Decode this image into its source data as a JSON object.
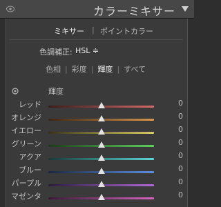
{
  "header": {
    "title": "カラーミキサー",
    "eye_icon": "eye-icon",
    "collapse_icon": "triangle-down-icon"
  },
  "tabs": {
    "mixer": "ミキサー",
    "separator": "|",
    "point_color": "ポイントカラー"
  },
  "adjust": {
    "label": "色調補正:",
    "value": "HSL ≑"
  },
  "sub_tabs": [
    {
      "label": "色相",
      "active": false
    },
    {
      "label": "彩度",
      "active": false
    },
    {
      "label": "輝度",
      "active": true
    },
    {
      "label": "すべて",
      "active": false
    }
  ],
  "section": {
    "label": "輝度",
    "target_icon": "target-adjust-icon"
  },
  "sliders": [
    {
      "label": "レッド",
      "value": "0",
      "level": 0.5,
      "from": "#3a1c1c",
      "to": "#d86868"
    },
    {
      "label": "オレンジ",
      "value": "0",
      "level": 0.5,
      "from": "#3b2614",
      "to": "#d9964e"
    },
    {
      "label": "イエロー",
      "value": "0",
      "level": 0.5,
      "from": "#37331a",
      "to": "#d8c868"
    },
    {
      "label": "グリーン",
      "value": "0",
      "level": 0.5,
      "from": "#1c3a1c",
      "to": "#5ecf5e"
    },
    {
      "label": "アクア",
      "value": "0",
      "level": 0.5,
      "from": "#183838",
      "to": "#5cd4d4"
    },
    {
      "label": "ブルー",
      "value": "0",
      "level": 0.5,
      "from": "#1c2640",
      "to": "#5b8fe0"
    },
    {
      "label": "パープル",
      "value": "0",
      "level": 0.5,
      "from": "#2c1c3c",
      "to": "#b06ad6"
    },
    {
      "label": "マゼンタ",
      "value": "0",
      "level": 0.5,
      "from": "#3a1a34",
      "to": "#d864c0"
    }
  ]
}
